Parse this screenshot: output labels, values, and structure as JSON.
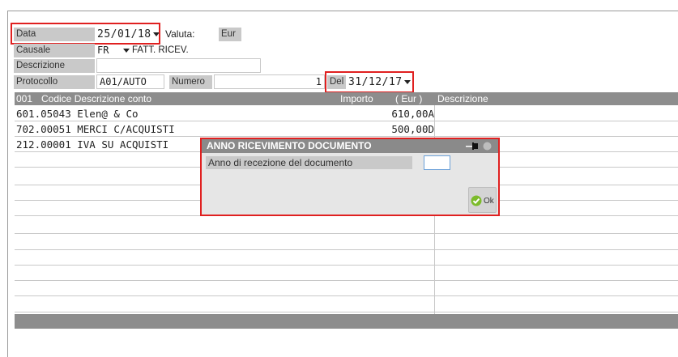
{
  "header": {
    "data_label": "Data",
    "data_value": "25/01/18",
    "valuta_label": "Valuta:",
    "valuta_value": "Eur",
    "causale_label": "Causale",
    "causale_code": "FR",
    "causale_desc": "FATT. RICEV.",
    "descrizione_label": "Descrizione",
    "descrizione_value": "",
    "protocollo_label": "Protocollo",
    "protocollo_value": "A01/AUTO",
    "numero_label": "Numero",
    "numero_value": "1",
    "del_label": "Del",
    "del_value": "31/12/17"
  },
  "grid": {
    "col_num": "001",
    "col_code": "Codice Descrizione conto",
    "col_importo": "Importo",
    "col_currency": "( Eur )",
    "col_desc": "Descrizione",
    "rows": [
      {
        "code": "601.05043 Elen@ & Co",
        "amount": "610,00A"
      },
      {
        "code": "702.00051 MERCI C/ACQUISTI",
        "amount": "500,00D"
      },
      {
        "code": "212.00001 IVA SU ACQUISTI",
        "amount": ""
      }
    ]
  },
  "dialog": {
    "title": "ANNO RICEVIMENTO DOCUMENTO",
    "field_label": "Anno di recezione del documento",
    "field_value": "",
    "ok_label": "Ok"
  },
  "colors": {
    "highlight": "#e02020",
    "header_gray": "#8d8d8d",
    "label_gray": "#c9c9c9"
  }
}
